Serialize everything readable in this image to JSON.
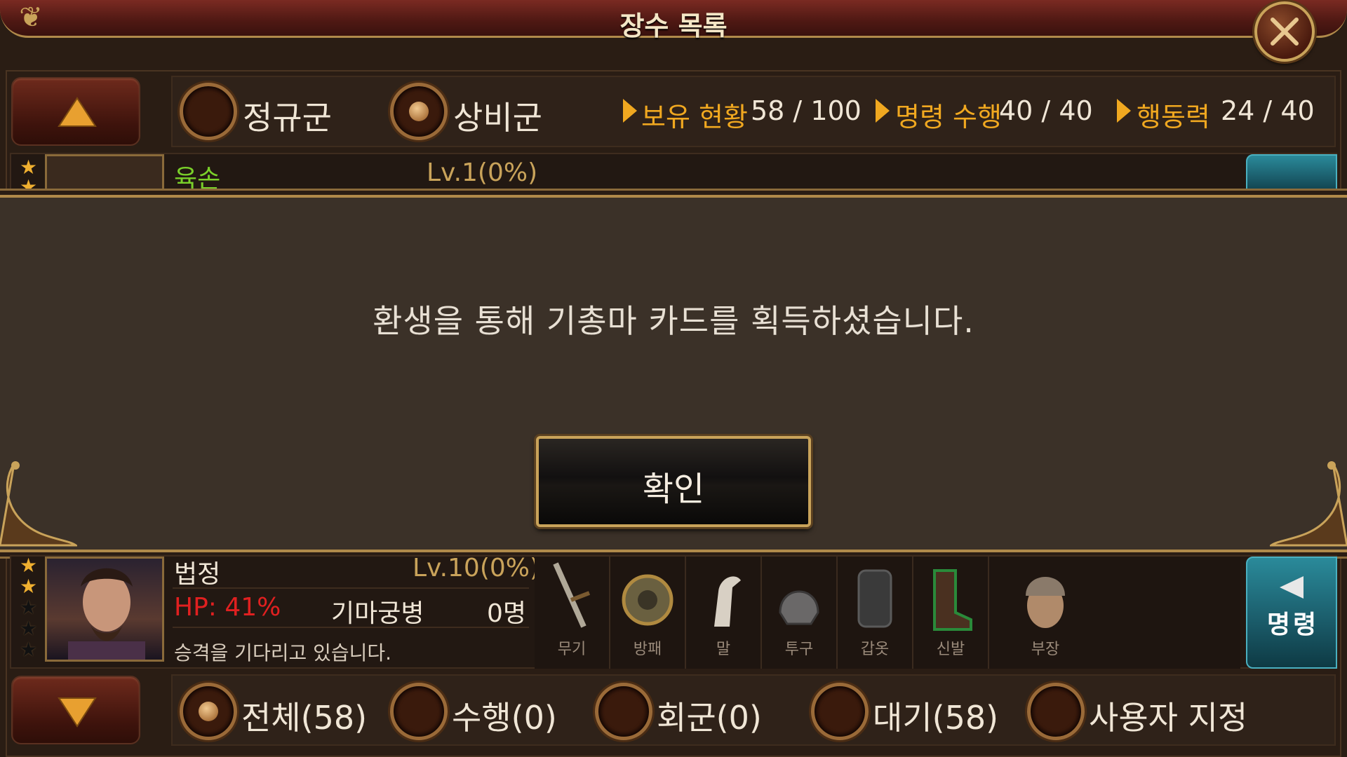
{
  "title": "장수 목록",
  "top_filters": {
    "regular_label": "정규군",
    "reserve_label": "상비군",
    "stats": [
      {
        "label": "보유 현황",
        "value": "58 / 100"
      },
      {
        "label": "명령 수행",
        "value": "40 / 40"
      },
      {
        "label": "행동력",
        "value": "24 / 40"
      }
    ]
  },
  "generals": [
    {
      "name": "육손",
      "level": "Lv.1(0%)",
      "stars": 5
    },
    {
      "name": "법정",
      "level": "Lv.10(0%)",
      "hp": "HP: 41%",
      "unit": "기마궁병",
      "troops": "0명",
      "status": "승격을 기다리고 있습니다.",
      "stars": 5,
      "gold_stars": 2
    }
  ],
  "equipment_labels": [
    "무기",
    "방패",
    "말",
    "투구",
    "갑옷",
    "신발",
    "부장"
  ],
  "command_label": "명령",
  "modal": {
    "message": "환생을 통해 기총마 카드를 획득하셨습니다.",
    "ok_label": "확인"
  },
  "bottom_filters": [
    {
      "label": "전체(58)",
      "selected": true
    },
    {
      "label": "수행(0)",
      "selected": false
    },
    {
      "label": "회군(0)",
      "selected": false
    },
    {
      "label": "대기(58)",
      "selected": false
    },
    {
      "label": "사용자 지정",
      "selected": false
    }
  ],
  "colors": {
    "accent_gold": "#c9a35a",
    "stat_orange": "#f0a820",
    "name_green": "#7ad02a",
    "hp_red": "#e02020",
    "command_teal": "#1a6a78"
  }
}
